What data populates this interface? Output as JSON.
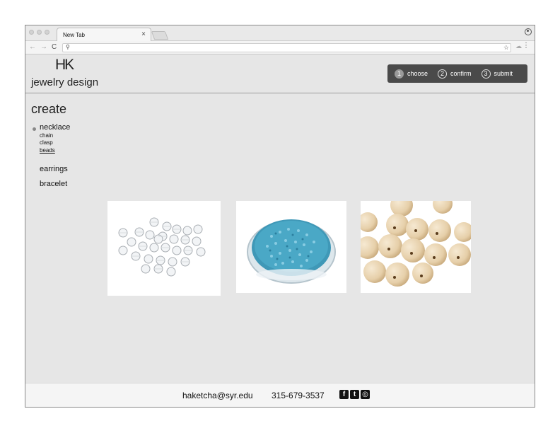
{
  "browser": {
    "tab_title": "New Tab",
    "tab_close": "×"
  },
  "brand": {
    "mark": "HK",
    "name": "jewelry design"
  },
  "steps": [
    {
      "num": "1",
      "label": "choose",
      "active": true
    },
    {
      "num": "2",
      "label": "confirm",
      "active": false
    },
    {
      "num": "3",
      "label": "submit",
      "active": false
    }
  ],
  "sidebar": {
    "title": "create",
    "items": [
      {
        "label": "necklace",
        "selected": true
      },
      {
        "label": "earrings",
        "selected": false
      },
      {
        "label": "bracelet",
        "selected": false
      }
    ],
    "subitems": [
      {
        "label": "chain",
        "current": false
      },
      {
        "label": "clasp",
        "current": false
      },
      {
        "label": "beads",
        "current": true
      }
    ]
  },
  "products": [
    {
      "icon": "crystal-beads-image"
    },
    {
      "icon": "blue-seed-beads-image"
    },
    {
      "icon": "wood-beads-image"
    }
  ],
  "footer": {
    "email": "haketcha@syr.edu",
    "phone": "315-679-3537",
    "social": {
      "facebook": "f",
      "twitter": "t",
      "instagram": "◎"
    }
  },
  "colors": {
    "page_bg": "#e6e6e6",
    "steps_bg": "#4a4a4a",
    "footer_bg": "#f5f5f5"
  }
}
